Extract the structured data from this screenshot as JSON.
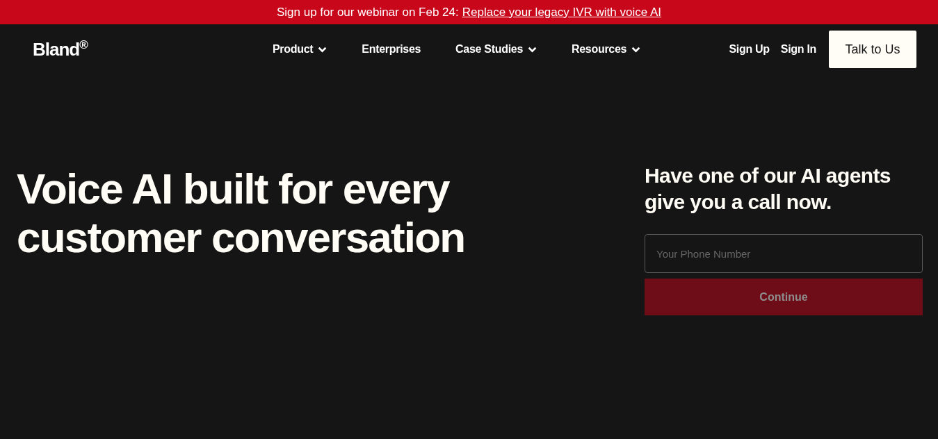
{
  "banner": {
    "text": "Sign up for our webinar on Feb 24:",
    "link": "Replace your legacy IVR with voice AI"
  },
  "header": {
    "logo": "Bland$^{®}$",
    "nav": [
      {
        "label": "Product",
        "has_menu": true
      },
      {
        "label": "Enterprises",
        "has_menu": false
      },
      {
        "label": "Case Studies",
        "has_menu": true
      },
      {
        "label": "Resources",
        "has_menu": true
      }
    ],
    "links": [
      "Sign Up",
      "Sign In"
    ],
    "cta": "Talk to Us"
  },
  "hero": {
    "headline": "Voice AI built for every customer conversation"
  },
  "call_form": {
    "title": "Have one of our AI agents give you a call now.",
    "phone": {
      "placeholder": "Your Phone Number"
    },
    "submit": {
      "label": "Continue",
      "disabled": true
    }
  }
}
